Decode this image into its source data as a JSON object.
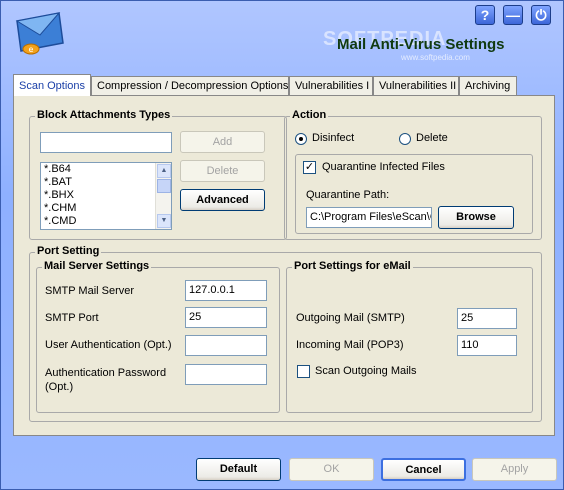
{
  "window": {
    "title": "Mail Anti-Virus Settings",
    "watermark": "SOFTPEDIA",
    "watermark_sub": "www.softpedia.com",
    "buttons": {
      "help": "?",
      "minimize": "—",
      "power": "⏻"
    }
  },
  "tabs": [
    {
      "label": "Scan Options",
      "active": true
    },
    {
      "label": "Compression / Decompression Options",
      "active": false
    },
    {
      "label": "Vulnerabilities I",
      "active": false
    },
    {
      "label": "Vulnerabilities II",
      "active": false
    },
    {
      "label": "Archiving",
      "active": false
    }
  ],
  "block_attachments": {
    "legend": "Block Attachments Types",
    "input_value": "",
    "add_label": "Add",
    "delete_label": "Delete",
    "advanced_label": "Advanced",
    "items": [
      "*.B64",
      "*.BAT",
      "*.BHX",
      "*.CHM",
      "*.CMD"
    ]
  },
  "action": {
    "legend": "Action",
    "disinfect_label": "Disinfect",
    "delete_label": "Delete",
    "selected": "Disinfect",
    "quarantine_label": "Quarantine Infected Files",
    "quarantine_checked": true,
    "path_label": "Quarantine Path:",
    "path_value": "C:\\Program Files\\eScan\\Q",
    "browse_label": "Browse"
  },
  "port_setting": {
    "legend": "Port Setting",
    "mail_server": {
      "legend": "Mail Server Settings",
      "smtp_server_label": "SMTP Mail Server",
      "smtp_server_value": "127.0.0.1",
      "smtp_port_label": "SMTP Port",
      "smtp_port_value": "25",
      "auth_label": "User Authentication (Opt.)",
      "auth_value": "",
      "password_label_1": "Authentication Password",
      "password_label_2": "(Opt.)",
      "password_value": ""
    },
    "email_ports": {
      "legend": "Port Settings for eMail",
      "outgoing_label": "Outgoing Mail (SMTP)",
      "outgoing_value": "25",
      "incoming_label": "Incoming Mail (POP3)",
      "incoming_value": "110",
      "scan_outgoing_label": "Scan Outgoing Mails",
      "scan_outgoing_checked": false
    }
  },
  "footer": {
    "default_label": "Default",
    "ok_label": "OK",
    "cancel_label": "Cancel",
    "apply_label": "Apply"
  },
  "colors": {
    "accent": "#1a3fa8",
    "title": "#103a10",
    "window_bg": "#9ab8ff"
  }
}
